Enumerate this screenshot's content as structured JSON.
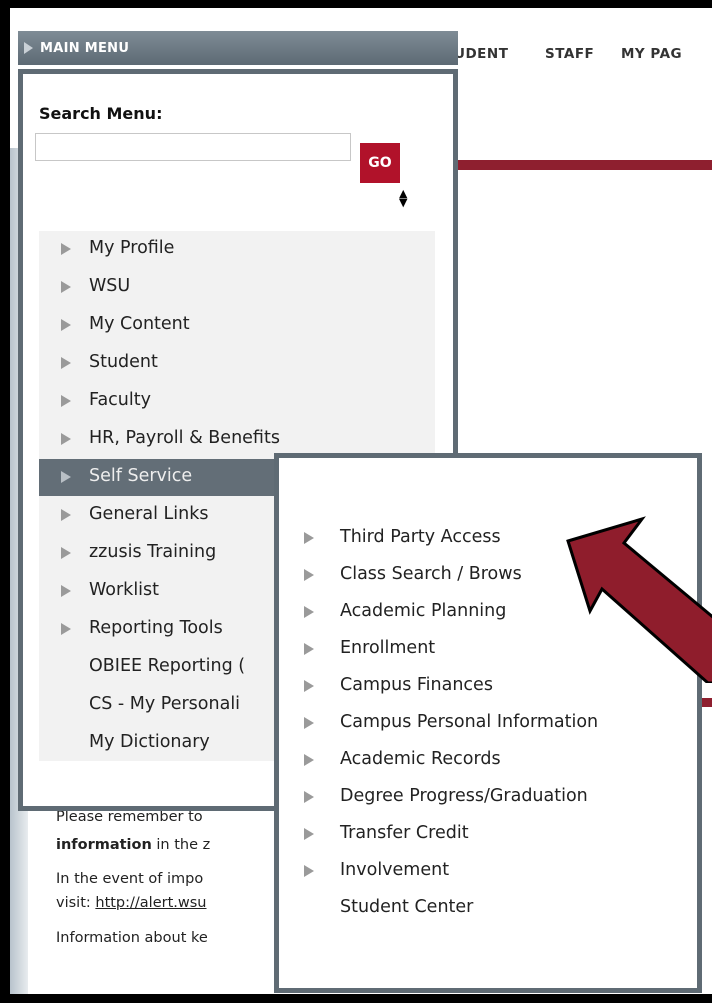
{
  "header": {
    "main_menu_label": "MAIN MENU",
    "nav": [
      "UDENT",
      "STAFF",
      "MY PAG"
    ]
  },
  "search": {
    "label": "Search Menu:",
    "value": "",
    "go_label": "GO"
  },
  "menu": {
    "items": [
      {
        "label": "My Profile",
        "arrow": true
      },
      {
        "label": "WSU",
        "arrow": true
      },
      {
        "label": "My Content",
        "arrow": true
      },
      {
        "label": "Student",
        "arrow": true
      },
      {
        "label": "Faculty",
        "arrow": true
      },
      {
        "label": "HR, Payroll & Benefits",
        "arrow": true
      },
      {
        "label": "Self Service",
        "arrow": true
      },
      {
        "label": "General Links",
        "arrow": true
      },
      {
        "label": "zzusis Training",
        "arrow": true
      },
      {
        "label": "Worklist",
        "arrow": true
      },
      {
        "label": "Reporting Tools",
        "arrow": true
      },
      {
        "label": "OBIEE Reporting (",
        "arrow": false
      },
      {
        "label": "CS - My Personali",
        "arrow": false
      },
      {
        "label": "My Dictionary",
        "arrow": false
      }
    ],
    "active_index": 6
  },
  "submenu": {
    "items": [
      {
        "label": "Third Party Access",
        "arrow": true
      },
      {
        "label": "Class Search / Brows",
        "arrow": true
      },
      {
        "label": "Academic Planning",
        "arrow": true
      },
      {
        "label": "Enrollment",
        "arrow": true
      },
      {
        "label": "Campus Finances",
        "arrow": true
      },
      {
        "label": "Campus Personal Information",
        "arrow": true
      },
      {
        "label": "Academic Records",
        "arrow": true
      },
      {
        "label": "Degree Progress/Graduation",
        "arrow": true
      },
      {
        "label": "Transfer Credit",
        "arrow": true
      },
      {
        "label": "Involvement",
        "arrow": true
      },
      {
        "label": "Student Center",
        "arrow": false
      }
    ]
  },
  "content": {
    "line1": "Please remember to",
    "line2_bold": "information",
    "line2_rest": " in the z",
    "line3": "In the event of impo",
    "line4_prefix": "visit: ",
    "line4_link": "http://alert.wsu",
    "line5": "Information about ke"
  },
  "colors": {
    "accent_red": "#b1122a",
    "bar_red": "#8e1f2f",
    "menu_gray": "#5f6b74",
    "arrow_fill": "#8f1d2c"
  }
}
